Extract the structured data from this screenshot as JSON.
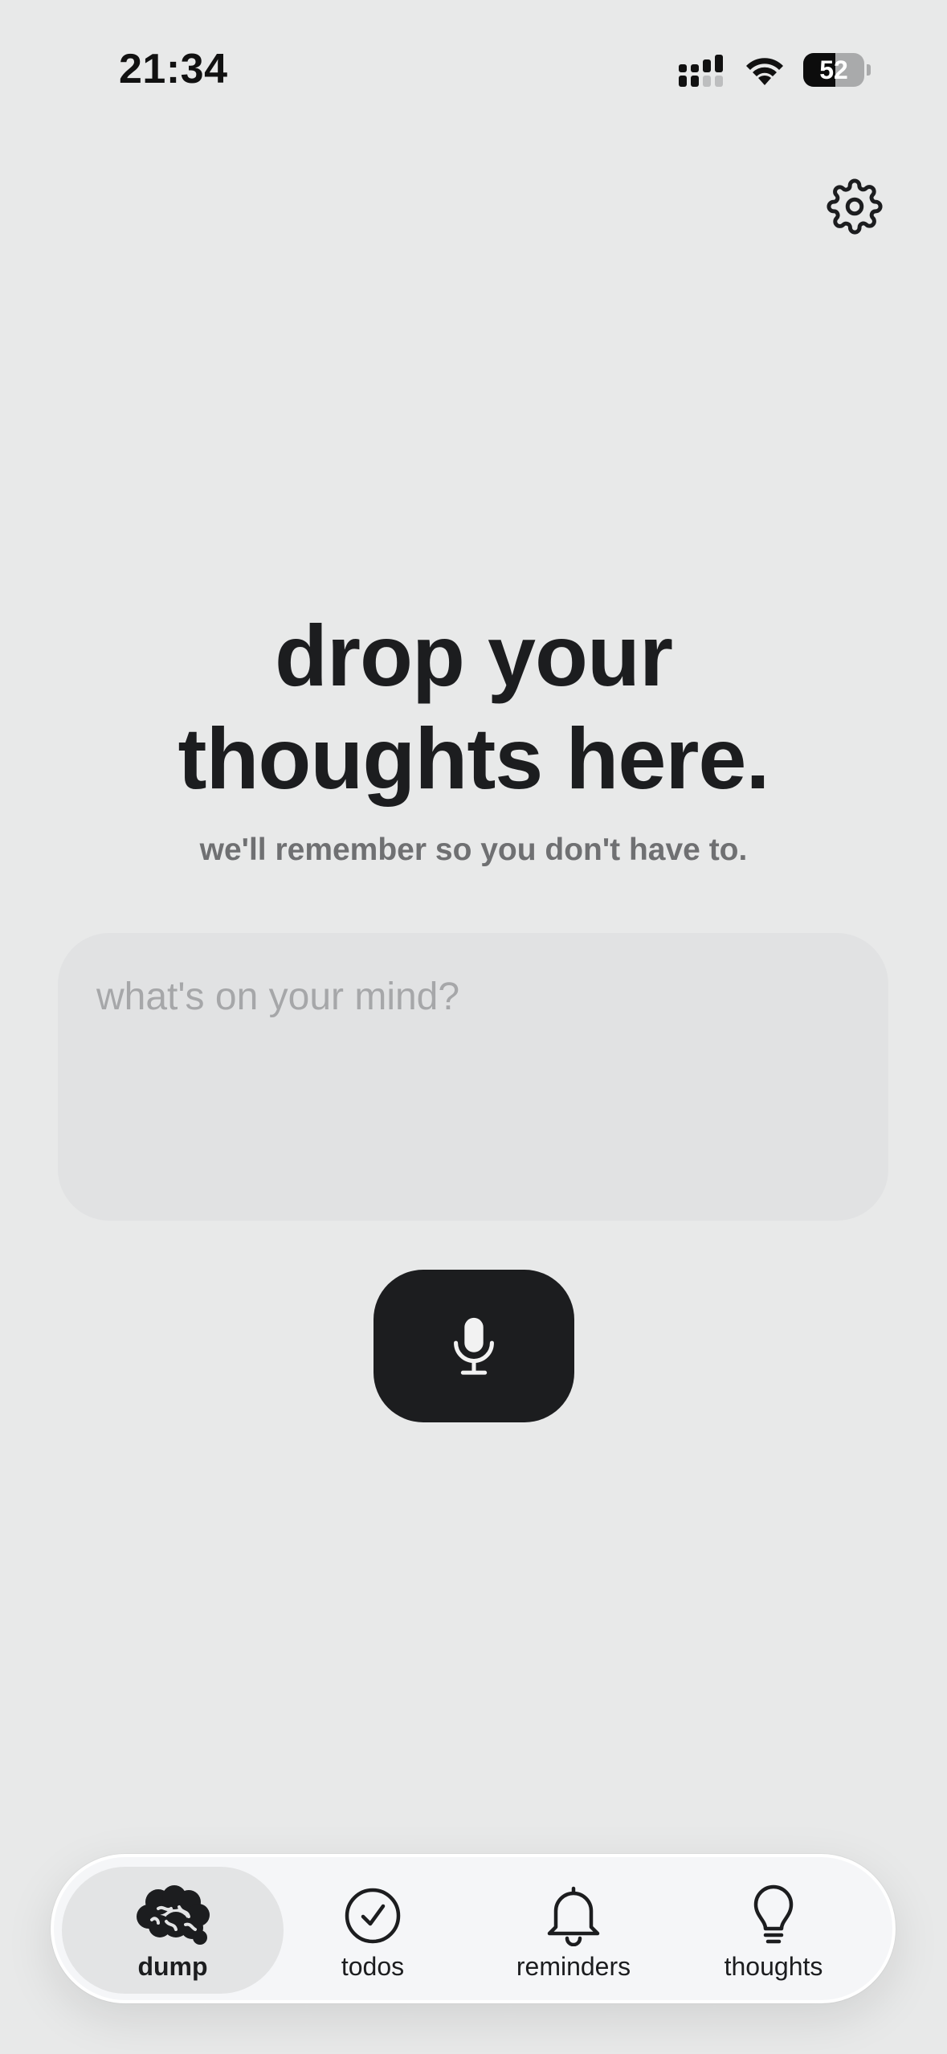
{
  "status_bar": {
    "time": "21:34",
    "battery_level": "52",
    "battery_fraction": 0.52
  },
  "header": {
    "settings_icon": "gear-icon"
  },
  "hero": {
    "title_line1": "drop your",
    "title_line2": "thoughts here.",
    "subtitle": "we'll remember so you don't have to."
  },
  "input": {
    "placeholder": "what's on your mind?",
    "value": ""
  },
  "mic": {
    "icon": "microphone-icon"
  },
  "tabs": [
    {
      "label": "dump",
      "icon": "brain-icon",
      "active": true
    },
    {
      "label": "todos",
      "icon": "check-circle-icon",
      "active": false
    },
    {
      "label": "reminders",
      "icon": "bell-icon",
      "active": false
    },
    {
      "label": "thoughts",
      "icon": "lightbulb-icon",
      "active": false
    }
  ],
  "colors": {
    "background": "#e8e9e9",
    "text_primary": "#1c1d1f",
    "text_secondary": "#6f7072",
    "input_background": "#e1e2e3",
    "tab_bar_background": "#f5f6f8",
    "active_tab_background": "#e3e4e5"
  }
}
